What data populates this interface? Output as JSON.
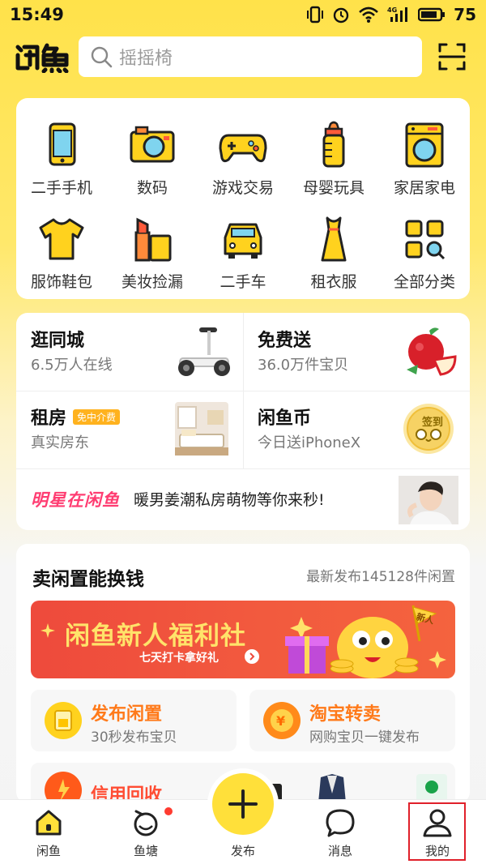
{
  "status": {
    "time": "15:49",
    "battery": "75",
    "network": "4G"
  },
  "header": {
    "search_placeholder": "摇摇椅"
  },
  "categories": [
    {
      "label": "二手手机",
      "icon": "phone-icon"
    },
    {
      "label": "数码",
      "icon": "camera-icon"
    },
    {
      "label": "游戏交易",
      "icon": "gamepad-icon"
    },
    {
      "label": "母婴玩具",
      "icon": "baby-bottle-icon"
    },
    {
      "label": "家居家电",
      "icon": "washing-machine-icon"
    },
    {
      "label": "服饰鞋包",
      "icon": "tshirt-icon"
    },
    {
      "label": "美妆捡漏",
      "icon": "cosmetics-icon"
    },
    {
      "label": "二手车",
      "icon": "car-icon"
    },
    {
      "label": "租衣服",
      "icon": "dress-icon"
    },
    {
      "label": "全部分类",
      "icon": "all-categories-icon"
    }
  ],
  "features": {
    "city": {
      "title": "逛同城",
      "sub": "6.5万人在线"
    },
    "free": {
      "title": "免费送",
      "sub": "36.0万件宝贝"
    },
    "rent": {
      "title": "租房",
      "badge": "免中介费",
      "sub": "真实房东"
    },
    "coin": {
      "title": "闲鱼币",
      "sub": "今日送iPhoneX",
      "stamp": "签到"
    },
    "star": {
      "logo": "明星在闲鱼",
      "text": "暖男姜潮私房萌物等你来秒!"
    }
  },
  "sell": {
    "title": "卖闲置能换钱",
    "meta": "最新发布145128件闲置",
    "banner_title": "闲鱼新人福利社",
    "banner_sub": "七天打卡拿好礼",
    "banner_tag": "新人",
    "publish": {
      "title": "发布闲置",
      "sub": "30秒发布宝贝"
    },
    "taobao": {
      "title": "淘宝转卖",
      "sub": "网购宝贝一键发布"
    },
    "credit": {
      "title": "信用回收"
    }
  },
  "tabbar": {
    "home": "闲鱼",
    "pond": "鱼塘",
    "publish": "发布",
    "messages": "消息",
    "mine": "我的"
  },
  "colors": {
    "brand": "#ffe03a",
    "accent": "#ff7a1a",
    "highlight": "#e0202a"
  }
}
